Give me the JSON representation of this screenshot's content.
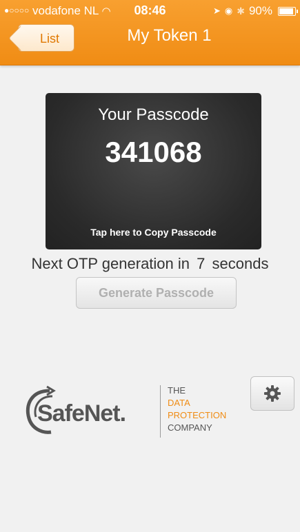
{
  "status": {
    "carrier": "vodafone NL",
    "time": "08:46",
    "battery": "90%",
    "battery_level": 0.9
  },
  "nav": {
    "back_label": "List",
    "title": "My Token 1"
  },
  "card": {
    "title": "Your Passcode",
    "passcode": "341068",
    "copy_hint": "Tap here to Copy Passcode"
  },
  "otp": {
    "prefix": "Next OTP generation in",
    "seconds": "7",
    "suffix": "seconds"
  },
  "generate_button": "Generate Passcode",
  "logo": {
    "brand": "SafeNet.",
    "tagline": [
      "THE",
      "DATA",
      "PROTECTION",
      "COMPANY"
    ]
  },
  "colors": {
    "accent": "#f08c14",
    "accent_text": "#e07800",
    "tagline_orange": "#f08c14",
    "tagline_gray": "#555555"
  },
  "icons": {
    "settings": "gear-icon",
    "back": "chevron-left-icon"
  }
}
